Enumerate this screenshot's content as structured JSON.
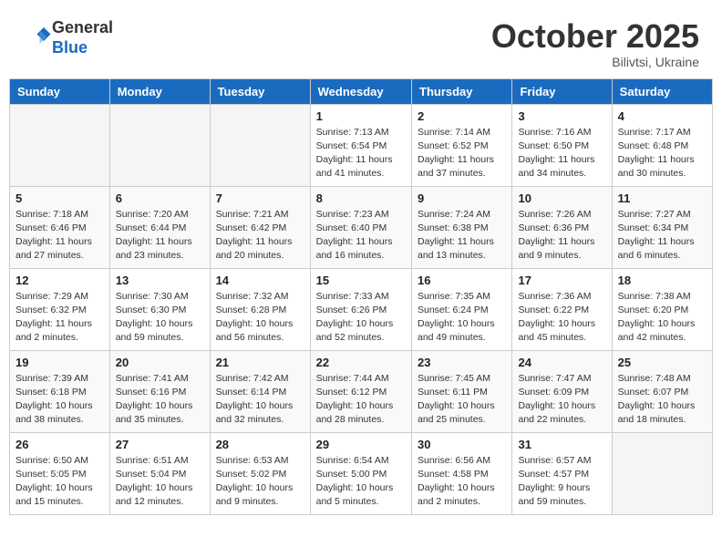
{
  "header": {
    "logo_line1": "General",
    "logo_line2": "Blue",
    "month": "October 2025",
    "location": "Bilivtsi, Ukraine"
  },
  "weekdays": [
    "Sunday",
    "Monday",
    "Tuesday",
    "Wednesday",
    "Thursday",
    "Friday",
    "Saturday"
  ],
  "weeks": [
    [
      {
        "day": "",
        "info": ""
      },
      {
        "day": "",
        "info": ""
      },
      {
        "day": "",
        "info": ""
      },
      {
        "day": "1",
        "info": "Sunrise: 7:13 AM\nSunset: 6:54 PM\nDaylight: 11 hours\nand 41 minutes."
      },
      {
        "day": "2",
        "info": "Sunrise: 7:14 AM\nSunset: 6:52 PM\nDaylight: 11 hours\nand 37 minutes."
      },
      {
        "day": "3",
        "info": "Sunrise: 7:16 AM\nSunset: 6:50 PM\nDaylight: 11 hours\nand 34 minutes."
      },
      {
        "day": "4",
        "info": "Sunrise: 7:17 AM\nSunset: 6:48 PM\nDaylight: 11 hours\nand 30 minutes."
      }
    ],
    [
      {
        "day": "5",
        "info": "Sunrise: 7:18 AM\nSunset: 6:46 PM\nDaylight: 11 hours\nand 27 minutes."
      },
      {
        "day": "6",
        "info": "Sunrise: 7:20 AM\nSunset: 6:44 PM\nDaylight: 11 hours\nand 23 minutes."
      },
      {
        "day": "7",
        "info": "Sunrise: 7:21 AM\nSunset: 6:42 PM\nDaylight: 11 hours\nand 20 minutes."
      },
      {
        "day": "8",
        "info": "Sunrise: 7:23 AM\nSunset: 6:40 PM\nDaylight: 11 hours\nand 16 minutes."
      },
      {
        "day": "9",
        "info": "Sunrise: 7:24 AM\nSunset: 6:38 PM\nDaylight: 11 hours\nand 13 minutes."
      },
      {
        "day": "10",
        "info": "Sunrise: 7:26 AM\nSunset: 6:36 PM\nDaylight: 11 hours\nand 9 minutes."
      },
      {
        "day": "11",
        "info": "Sunrise: 7:27 AM\nSunset: 6:34 PM\nDaylight: 11 hours\nand 6 minutes."
      }
    ],
    [
      {
        "day": "12",
        "info": "Sunrise: 7:29 AM\nSunset: 6:32 PM\nDaylight: 11 hours\nand 2 minutes."
      },
      {
        "day": "13",
        "info": "Sunrise: 7:30 AM\nSunset: 6:30 PM\nDaylight: 10 hours\nand 59 minutes."
      },
      {
        "day": "14",
        "info": "Sunrise: 7:32 AM\nSunset: 6:28 PM\nDaylight: 10 hours\nand 56 minutes."
      },
      {
        "day": "15",
        "info": "Sunrise: 7:33 AM\nSunset: 6:26 PM\nDaylight: 10 hours\nand 52 minutes."
      },
      {
        "day": "16",
        "info": "Sunrise: 7:35 AM\nSunset: 6:24 PM\nDaylight: 10 hours\nand 49 minutes."
      },
      {
        "day": "17",
        "info": "Sunrise: 7:36 AM\nSunset: 6:22 PM\nDaylight: 10 hours\nand 45 minutes."
      },
      {
        "day": "18",
        "info": "Sunrise: 7:38 AM\nSunset: 6:20 PM\nDaylight: 10 hours\nand 42 minutes."
      }
    ],
    [
      {
        "day": "19",
        "info": "Sunrise: 7:39 AM\nSunset: 6:18 PM\nDaylight: 10 hours\nand 38 minutes."
      },
      {
        "day": "20",
        "info": "Sunrise: 7:41 AM\nSunset: 6:16 PM\nDaylight: 10 hours\nand 35 minutes."
      },
      {
        "day": "21",
        "info": "Sunrise: 7:42 AM\nSunset: 6:14 PM\nDaylight: 10 hours\nand 32 minutes."
      },
      {
        "day": "22",
        "info": "Sunrise: 7:44 AM\nSunset: 6:12 PM\nDaylight: 10 hours\nand 28 minutes."
      },
      {
        "day": "23",
        "info": "Sunrise: 7:45 AM\nSunset: 6:11 PM\nDaylight: 10 hours\nand 25 minutes."
      },
      {
        "day": "24",
        "info": "Sunrise: 7:47 AM\nSunset: 6:09 PM\nDaylight: 10 hours\nand 22 minutes."
      },
      {
        "day": "25",
        "info": "Sunrise: 7:48 AM\nSunset: 6:07 PM\nDaylight: 10 hours\nand 18 minutes."
      }
    ],
    [
      {
        "day": "26",
        "info": "Sunrise: 6:50 AM\nSunset: 5:05 PM\nDaylight: 10 hours\nand 15 minutes."
      },
      {
        "day": "27",
        "info": "Sunrise: 6:51 AM\nSunset: 5:04 PM\nDaylight: 10 hours\nand 12 minutes."
      },
      {
        "day": "28",
        "info": "Sunrise: 6:53 AM\nSunset: 5:02 PM\nDaylight: 10 hours\nand 9 minutes."
      },
      {
        "day": "29",
        "info": "Sunrise: 6:54 AM\nSunset: 5:00 PM\nDaylight: 10 hours\nand 5 minutes."
      },
      {
        "day": "30",
        "info": "Sunrise: 6:56 AM\nSunset: 4:58 PM\nDaylight: 10 hours\nand 2 minutes."
      },
      {
        "day": "31",
        "info": "Sunrise: 6:57 AM\nSunset: 4:57 PM\nDaylight: 9 hours\nand 59 minutes."
      },
      {
        "day": "",
        "info": ""
      }
    ]
  ]
}
